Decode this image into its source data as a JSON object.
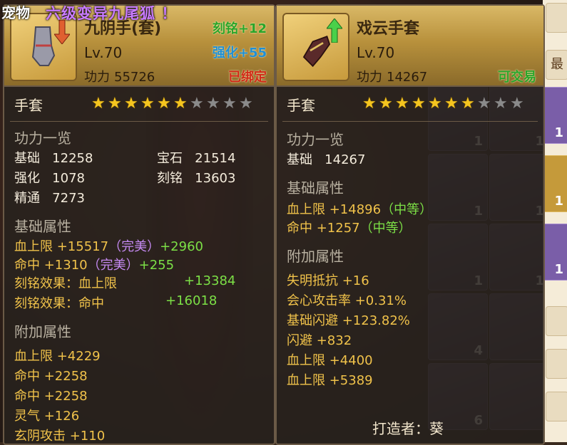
{
  "pet": {
    "tag": "宠物",
    "name": "六级变异九尾狐 ！"
  },
  "left": {
    "name": "九阴手(套)",
    "level": "Lv.70",
    "power_label": "功力",
    "power": "55726",
    "engrave": "刻铭+12",
    "strengthen": "强化+55",
    "bind": "已绑定",
    "slot": "手套",
    "stars_total": 10,
    "stars_on": 6,
    "overview_title": "功力一览",
    "overview": [
      {
        "k": "基础",
        "v": "12258"
      },
      {
        "k": "宝石",
        "v": "21514"
      },
      {
        "k": "强化",
        "v": "1078"
      },
      {
        "k": "刻铭",
        "v": "13603"
      },
      {
        "k": "精通",
        "v": "7273"
      }
    ],
    "base_title": "基础属性",
    "base": [
      {
        "a": "血上限 +15517",
        "q": "（完美）",
        "b": "+2960"
      },
      {
        "a": "命中 +1310",
        "q": "（完美）",
        "b": "+255"
      }
    ],
    "engrave_effects": [
      {
        "a": "刻铭效果：血上限",
        "b": "+13384"
      },
      {
        "a": "刻铭效果：命中",
        "b": "+16018"
      }
    ],
    "extra_title": "附加属性",
    "extra": [
      "血上限 +4229",
      "命中 +2258",
      "命中 +2258",
      "灵气 +126",
      "玄阴攻击 +110"
    ]
  },
  "right": {
    "name": "戏云手套",
    "level": "Lv.70",
    "power_label": "功力",
    "power": "14267",
    "trade": "可交易",
    "slot": "手套",
    "stars_total": 10,
    "stars_on": 7,
    "overview_title": "功力一览",
    "overview": [
      {
        "k": "基础",
        "v": "14267"
      }
    ],
    "base_title": "基础属性",
    "base": [
      {
        "a": "血上限 +14896",
        "q": "（中等）"
      },
      {
        "a": "命中 +1257",
        "q": "（中等）"
      }
    ],
    "extra_title": "附加属性",
    "extra": [
      "失明抵抗 +16",
      "会心攻击率 +0.31%",
      "基础闪避 +123.82%",
      "闪避 +832",
      "血上限 +4400",
      "血上限 +5389"
    ],
    "maker": "打造者：葵"
  },
  "inventory": {
    "counts": [
      "1",
      "1",
      "1",
      "1",
      "1",
      "1",
      "4",
      "6"
    ]
  },
  "side": {
    "label": "最",
    "counts": [
      "1",
      "1",
      "1"
    ]
  },
  "colors": {
    "gold": "#f0c24a",
    "purple": "#c58af2",
    "green": "#7ce046",
    "star": "#f5c51f"
  }
}
